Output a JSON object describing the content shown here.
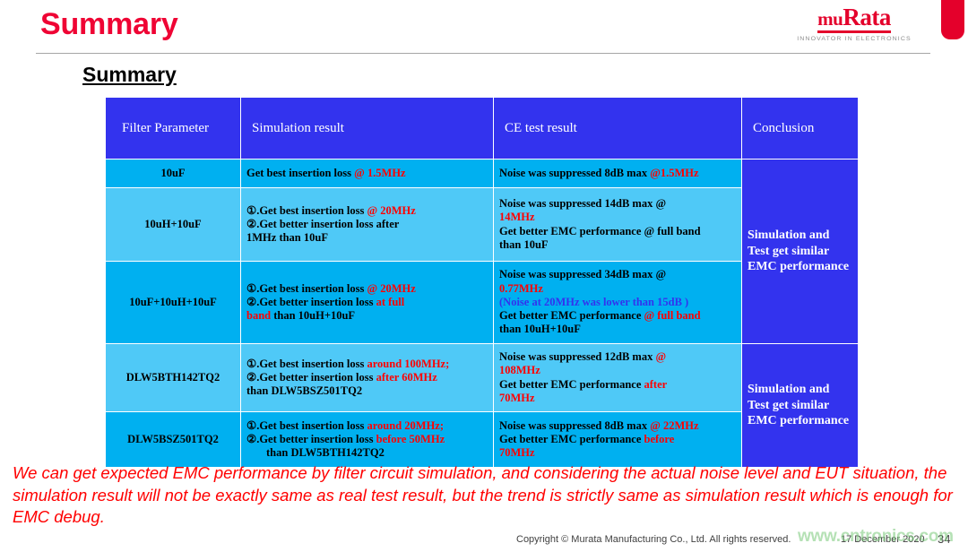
{
  "header": {
    "title": "Summary",
    "logo_mark_pre": "mu",
    "logo_mark_post": "Rata",
    "logo_tagline": "INNOVATOR IN ELECTRONICS"
  },
  "section": {
    "heading": "Summary"
  },
  "table": {
    "columns": [
      "Filter Parameter",
      "Simulation result",
      "CE test result",
      "Conclusion"
    ],
    "rows": [
      {
        "parameter": "10uF",
        "simulation_plain_1": "Get best insertion loss ",
        "simulation_hl_1": "@ 1.5MHz",
        "ce_plain_1": "Noise was suppressed 8dB max ",
        "ce_hl_1": "@1.5MHz"
      },
      {
        "parameter": "10uH+10uF",
        "sim_line1_plain": "①.Get best insertion loss ",
        "sim_line1_hl": "@ 20MHz",
        "sim_line2": "②.Get better insertion loss after",
        "sim_line3": "1MHz than 10uF",
        "ce_line1": "Noise was suppressed 14dB max @",
        "ce_line2_hl": "14MHz",
        "ce_line3": "Get better EMC performance @ full band",
        "ce_line4": "than  10uF"
      },
      {
        "parameter": "10uF+10uH+10uF",
        "sim_line1_plain": "①.Get best insertion loss ",
        "sim_line1_hl": "@ 20MHz",
        "sim_line2_plain": "②.Get better insertion loss ",
        "sim_line2_hl": "at full",
        "sim_line3_hl": " band",
        "sim_line3_plain": " than 10uH+10uF",
        "ce_line1": "Noise was suppressed 34dB max @",
        "ce_line2_hl": "0.77MHz",
        "ce_line3_blue": "(Noise at 20MHz was lower than 15dB )",
        "ce_line4_plain": "Get better EMC performance ",
        "ce_line4_hl": "@ full band",
        "ce_line5": "than  10uH+10uF"
      },
      {
        "parameter": "DLW5BTH142TQ2",
        "sim_line1_plain": "①.Get best insertion loss ",
        "sim_line1_hl": "around 100MHz;",
        "sim_line2_plain": "②.Get better insertion loss ",
        "sim_line2_hl": "after 60MHz",
        "sim_line3": " than DLW5BSZ501TQ2",
        "ce_line1_plain": "Noise was suppressed 12dB max ",
        "ce_line1_hl": "@",
        "ce_line2_hl": "108MHz",
        "ce_line3_plain": "Get better EMC performance ",
        "ce_line3_hl": "after",
        "ce_line4_hl": "70MHz"
      },
      {
        "parameter": "DLW5BSZ501TQ2",
        "sim_line1_plain": "①.Get best insertion loss ",
        "sim_line1_hl": "around 20MHz;",
        "sim_line2_plain": "②.Get better insertion loss ",
        "sim_line2_hl": "before 50MHz",
        "sim_line3": "than DLW5BTH142TQ2",
        "ce_line1_plain": "Noise was suppressed 8dB max ",
        "ce_line1_hl": "@ 22MHz",
        "ce_line2_plain": "Get better EMC performance ",
        "ce_line2_hl": "before",
        "ce_line3_hl": "70MHz"
      }
    ],
    "conclusion_top": "Simulation and Test get similar EMC performance",
    "conclusion_bottom": "Simulation and Test get similar EMC performance"
  },
  "closing_statement": "We can get expected EMC performance by filter circuit simulation, and considering the actual noise level and EUT situation, the simulation result will not be exactly same as real test result, but the trend is strictly same as simulation result which is enough for EMC debug.",
  "footer": {
    "copyright": "Copyright © Murata Manufacturing Co., Ltd. All rights reserved.",
    "date": "17 December 2020",
    "page_number": "34",
    "watermark": "www.cntronics.com"
  },
  "colors": {
    "title_red": "#ef0434",
    "header_blue": "#3333ee",
    "cell_cyan_dark": "#00b0f0",
    "cell_cyan_light": "#4fc9f7",
    "highlight_red": "#ff0000",
    "highlight_blue": "#3333ee",
    "brand_red": "#e4002b"
  }
}
